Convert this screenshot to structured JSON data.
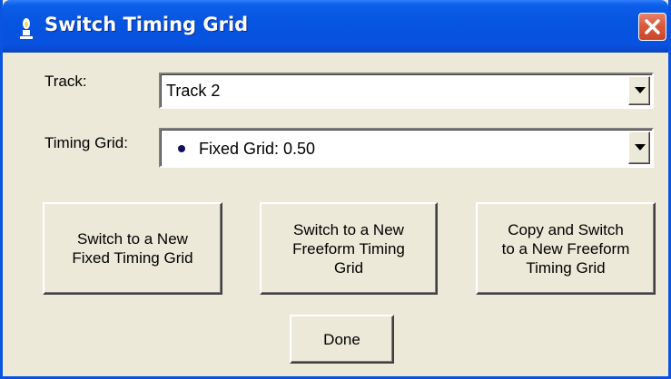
{
  "window": {
    "title": "Switch Timing Grid"
  },
  "track": {
    "label": "Track:",
    "value": "Track 2"
  },
  "timing_grid": {
    "label": "Timing Grid:",
    "value": "Fixed Grid: 0.50"
  },
  "buttons": {
    "new_fixed": "Switch to a New\nFixed Timing Grid",
    "new_freeform": "Switch to a New\nFreeform Timing\nGrid",
    "copy_freeform": "Copy and Switch\nto a New Freeform\nTiming Grid",
    "done": "Done"
  },
  "icons": {
    "title": "candle-icon",
    "close": "close-icon",
    "dropdown": "chevron-down-icon",
    "grid_marker": "bullet-icon"
  },
  "colors": {
    "titlebar": "#0654e0",
    "close_button": "#d95b3c",
    "dialog_background": "#ece9d8"
  }
}
